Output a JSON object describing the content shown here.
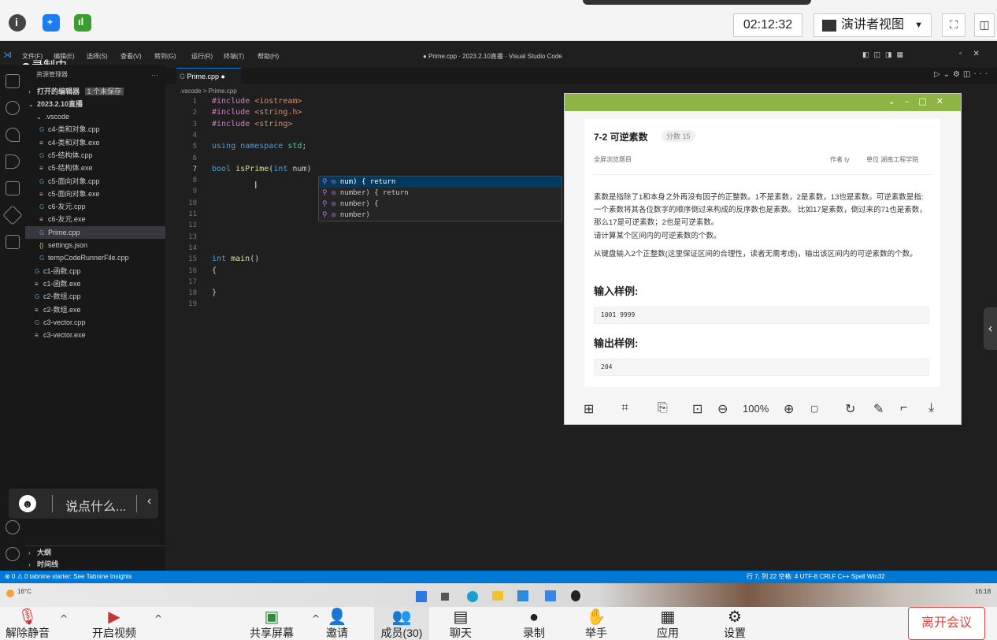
{
  "meeting_top": {
    "time": "02:12:32",
    "presenter_view": "演讲者视图",
    "info_icon": "info-icon",
    "shield_icon": "shield-icon",
    "signal_icon": "signal-icon"
  },
  "vscode": {
    "menu": [
      "文件(F)",
      "编辑(E)",
      "选择(S)",
      "查看(V)",
      "转到(G)",
      "运行(R)",
      "终端(T)",
      "帮助(H)"
    ],
    "window_title": "● Prime.cpp · 2023.2.10直播 · Visual Studio Code",
    "recording_badge": "录制中",
    "sidebar": {
      "header": "资源管理器",
      "open_editors": "打开的编辑器",
      "unsaved_badge": "1 个未保存",
      "folder": "2023.2.10直播",
      "items": [
        {
          "label": ".vscode",
          "indent": 1
        },
        {
          "label": "c4-类和对象.cpp",
          "indent": 2
        },
        {
          "label": "c4-类和对象.exe",
          "indent": 2
        },
        {
          "label": "c5-结构体.cpp",
          "indent": 2
        },
        {
          "label": "c5-结构体.exe",
          "indent": 2
        },
        {
          "label": "c5-面向对象.cpp",
          "indent": 2
        },
        {
          "label": "c5-面向对象.exe",
          "indent": 2
        },
        {
          "label": "c6-友元.cpp",
          "indent": 2
        },
        {
          "label": "c6-友元.exe",
          "indent": 2
        },
        {
          "label": "Prime.cpp",
          "indent": 2,
          "selected": true
        },
        {
          "label": "settings.json",
          "indent": 2
        },
        {
          "label": "tempCodeRunnerFile.cpp",
          "indent": 2
        },
        {
          "label": "c1-函数.cpp",
          "indent": 1
        },
        {
          "label": "c1-函数.exe",
          "indent": 1
        },
        {
          "label": "c2-数组.cpp",
          "indent": 1
        },
        {
          "label": "c2-数组.exe",
          "indent": 1
        },
        {
          "label": "c3-vector.cpp",
          "indent": 1
        },
        {
          "label": "c3-vector.exe",
          "indent": 1
        }
      ],
      "outline": "大纲",
      "timeline": "时间线"
    },
    "chat_placeholder": "说点什么...",
    "tab": "Prime.cpp",
    "breadcrumb": ".vscode > Prime.cpp",
    "code_lines": [
      "#include <iostream>",
      "#include <string.h>",
      "#include <string>",
      "",
      "using namespace std;",
      "",
      "bool isPrime(int num)",
      "",
      "",
      "",
      "",
      "",
      "",
      "",
      "int main()",
      "{",
      "",
      "}",
      ""
    ],
    "suggestions": [
      "num) { return",
      "number) { return",
      "number) {",
      "number)"
    ],
    "status_left": "⊗ 0 ⚠ 0   tabnine starter:   See Tabnine Insights",
    "status_right": "行 7, 列 22   空格: 4   UTF-8   CRLF   C++   Spell   Win32"
  },
  "problem": {
    "title": "7-2 可逆素数",
    "score": "分数 15",
    "fullscreen": "全屏浏览题目",
    "author": "作者 ty",
    "unit": "单位 湖南工程学院",
    "desc1": "素数是指除了1和本身之外再没有因子的正整数。1不是素数，2是素数，13也是素数。可逆素数是指: 一个素数将其各位数字的顺序倒过来构成的反序数也是素数。 比如17是素数，倒过来的71也是素数，那么17是可逆素数；2也是可逆素数。",
    "desc2": "请计算某个区间内的可逆素数的个数。",
    "desc3": "从键盘输入2个正整数(这里保证区间的合理性，读者无需考虑)，输出该区间内的可逆素数的个数。",
    "input_title": "输入样例:",
    "input_sample": "1001  9999",
    "output_title": "输出样例:",
    "output_sample": "204",
    "zoom": "100%"
  },
  "taskbar": {
    "weather": "16°C",
    "clock": "16:18"
  },
  "meeting_bottom": {
    "buttons": [
      "解除静音",
      "开启视频",
      "共享屏幕",
      "邀请",
      "成员(30)",
      "聊天",
      "录制",
      "举手",
      "应用",
      "设置"
    ],
    "leave": "离开会议"
  }
}
